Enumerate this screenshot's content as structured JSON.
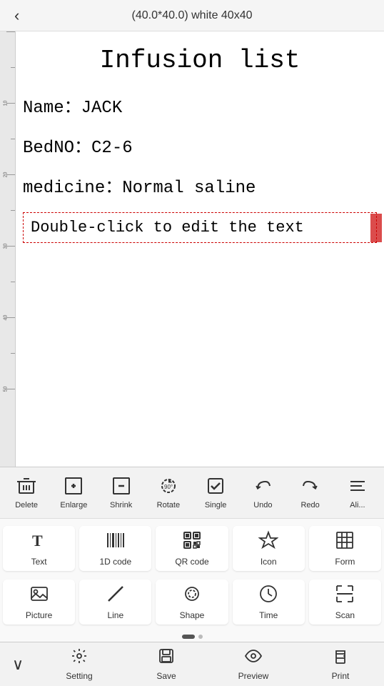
{
  "header": {
    "title": "(40.0*40.0) white 40x40",
    "back_icon": "‹"
  },
  "canvas": {
    "title": "Infusion list",
    "lines": [
      "Name：JACK",
      "BedNO：C2-6",
      "medicine：Normal saline"
    ],
    "edit_placeholder": "Double-click to edit the text"
  },
  "toolbar_row1": {
    "buttons": [
      {
        "id": "delete",
        "label": "Delete"
      },
      {
        "id": "enlarge",
        "label": "Enlarge"
      },
      {
        "id": "shrink",
        "label": "Shrink"
      },
      {
        "id": "rotate",
        "label": "Rotate"
      },
      {
        "id": "single",
        "label": "Single"
      },
      {
        "id": "undo",
        "label": "Undo"
      },
      {
        "id": "redo",
        "label": "Redo"
      },
      {
        "id": "align",
        "label": "Ali..."
      }
    ]
  },
  "tool_grid_row1": [
    {
      "id": "text",
      "label": "Text"
    },
    {
      "id": "1dcode",
      "label": "1D code"
    },
    {
      "id": "qrcode",
      "label": "QR code"
    },
    {
      "id": "icon",
      "label": "Icon"
    },
    {
      "id": "form",
      "label": "Form"
    }
  ],
  "tool_grid_row2": [
    {
      "id": "picture",
      "label": "Picture"
    },
    {
      "id": "line",
      "label": "Line"
    },
    {
      "id": "shape",
      "label": "Shape"
    },
    {
      "id": "time",
      "label": "Time"
    },
    {
      "id": "scan",
      "label": "Scan"
    }
  ],
  "bottom_nav": {
    "expand_label": "∨",
    "items": [
      {
        "id": "setting",
        "label": "Setting"
      },
      {
        "id": "save",
        "label": "Save"
      },
      {
        "id": "preview",
        "label": "Preview"
      },
      {
        "id": "print",
        "label": "Print"
      }
    ]
  }
}
